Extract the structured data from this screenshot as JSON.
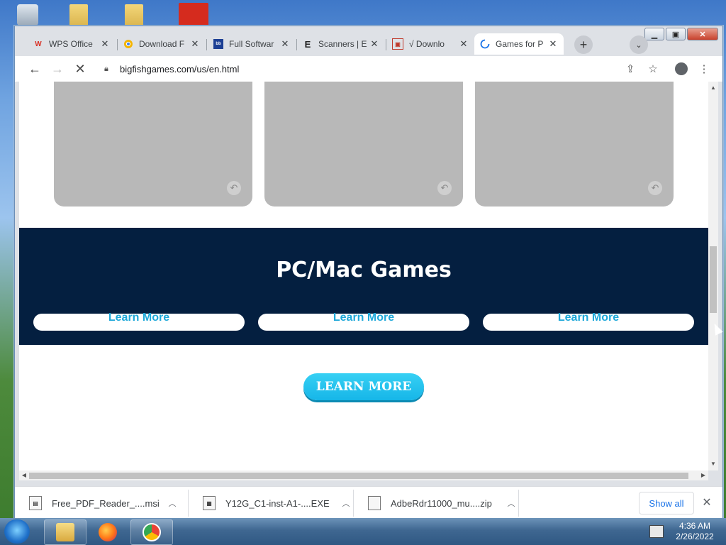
{
  "browser": {
    "tabs": [
      {
        "title": "WPS Office",
        "favicon": "wps-icon",
        "favicon_color": "#d93025",
        "active": false
      },
      {
        "title": "Download F",
        "favicon": "chrome-favicon",
        "favicon_color": "#f4b400",
        "active": false
      },
      {
        "title": "Full Softwar",
        "favicon": "bobby-icon",
        "favicon_color": "#1c3f94",
        "active": false
      },
      {
        "title": "Scanners | E",
        "favicon": "e-icon",
        "favicon_color": "#222222",
        "active": false
      },
      {
        "title": "√ Downlo",
        "favicon": "download-icon",
        "favicon_color": "#c0392b",
        "active": false
      },
      {
        "title": "Games for P",
        "favicon": "loading-spinner-icon",
        "favicon_color": "#1a73e8",
        "active": true
      }
    ],
    "url": "bigfishgames.com/us/en.html"
  },
  "page": {
    "section_title": "PC/Mac Games",
    "learn_more_buttons": [
      "Learn More",
      "Learn More",
      "Learn More"
    ],
    "cta_label": "LEARN MORE",
    "accent_color": "#1ea8d9",
    "band_color": "#041f40"
  },
  "downloads": {
    "items": [
      {
        "name": "Free_PDF_Reader_....msi",
        "icon": "msi-file-icon"
      },
      {
        "name": "Y12G_C1-inst-A1-....EXE",
        "icon": "exe-file-icon"
      },
      {
        "name": "AdbeRdr11000_mu....zip",
        "icon": "zip-file-icon"
      }
    ],
    "show_all_label": "Show all"
  },
  "taskbar": {
    "time": "4:36 AM",
    "date": "2/26/2022"
  }
}
